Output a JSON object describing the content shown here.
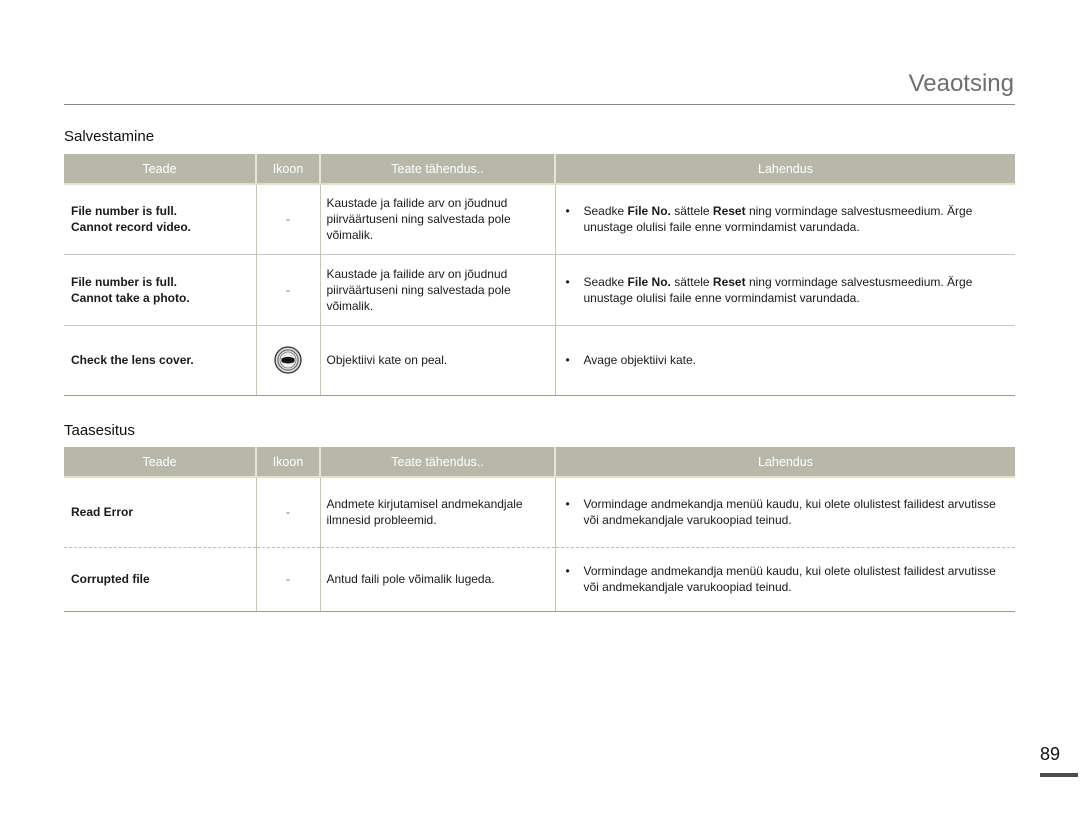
{
  "header": {
    "title": "Veaotsing"
  },
  "columns": [
    "Teade",
    "Ikoon",
    "Teate tähendus..",
    "Lahendus"
  ],
  "sections": [
    {
      "title": "Salvestamine",
      "rows": [
        {
          "message_line1": "File number is full.",
          "message_line2": "Cannot record video.",
          "icon": "-",
          "meaning": "Kaustade ja failide arv on jõudnud piirväärtuseni ning salvestada pole võimalik.",
          "solution_pre": "Seadke ",
          "solution_b1": "File No.",
          "solution_mid": " sättele ",
          "solution_b2": "Reset",
          "solution_post": " ning vormindage salvestusmeedium. Ärge unustage olulisi faile enne vormindamist varundada."
        },
        {
          "message_line1": "File number is full.",
          "message_line2": "Cannot take a photo.",
          "icon": "-",
          "meaning": "Kaustade ja failide arv on jõudnud piirväärtuseni ning salvestada pole võimalik.",
          "solution_pre": "Seadke ",
          "solution_b1": "File No.",
          "solution_mid": " sättele ",
          "solution_b2": "Reset",
          "solution_post": " ning vormindage salvestusmeedium. Ärge unustage olulisi faile enne vormindamist varundada."
        },
        {
          "message_line1": "Check the lens cover.",
          "icon_name": "lens-cover-icon",
          "meaning": "Objektiivi kate on peal.",
          "solution": "Avage objektiivi kate."
        }
      ]
    },
    {
      "title": "Taasesitus",
      "rows": [
        {
          "message_line1": "Read Error",
          "icon": "-",
          "meaning": "Andmete kirjutamisel andmekandjale ilmnesid probleemid.",
          "solution": "Vormindage andmekandja menüü kaudu, kui olete olulistest failidest arvutisse või andmekandjale varukoopiad teinud."
        },
        {
          "message_line1": "Corrupted file",
          "icon": "-",
          "meaning": "Antud faili pole võimalik lugeda.",
          "solution": "Vormindage andmekandja menüü kaudu, kui olete olulistest failidest arvutisse või andmekandjale varukoopiad teinud."
        }
      ]
    }
  ],
  "bullet": "•",
  "footer": {
    "page_number": "89"
  }
}
